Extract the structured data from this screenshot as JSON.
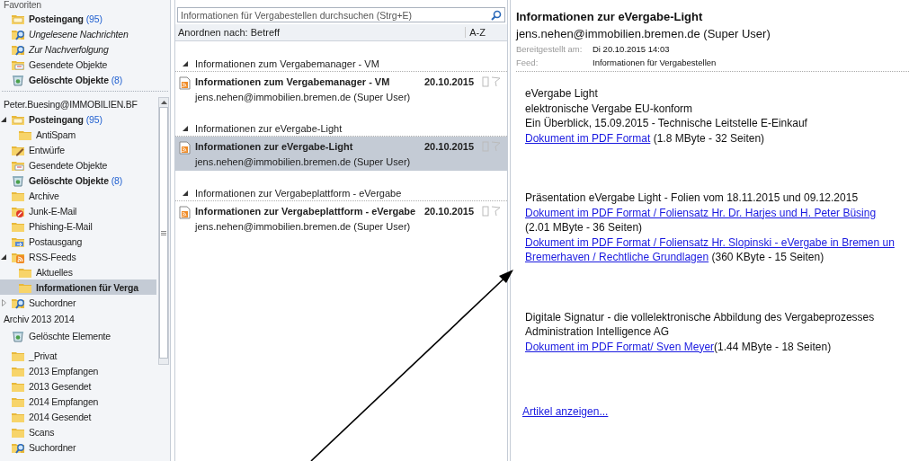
{
  "sidebar": {
    "favorites_header": "Favoriten",
    "favorites": [
      {
        "label": "Posteingang",
        "kind": "inbox",
        "bold": true,
        "italic": false,
        "count": "(95)",
        "selected": false
      },
      {
        "label": "Ungelesene Nachrichten",
        "kind": "search",
        "bold": false,
        "italic": true,
        "selected": false
      },
      {
        "label": "Zur Nachverfolgung",
        "kind": "search",
        "bold": false,
        "italic": true,
        "selected": false
      },
      {
        "label": "Gesendete Objekte",
        "kind": "sent",
        "bold": false,
        "italic": false,
        "selected": false
      },
      {
        "label": "Gelöschte Objekte",
        "kind": "deleted",
        "bold": true,
        "italic": false,
        "count": "(8)",
        "selected": false
      }
    ],
    "account": "Peter.Buesing@IMMOBILIEN.BF",
    "folders": [
      {
        "label": "Posteingang",
        "kind": "inbox",
        "bold": true,
        "italic": false,
        "count": "(95)",
        "selected": false,
        "expanded": true,
        "children": [
          {
            "label": "AntiSpam",
            "kind": "folder",
            "bold": false,
            "italic": false,
            "selected": false
          }
        ]
      },
      {
        "label": "Entwürfe",
        "kind": "drafts",
        "bold": false,
        "italic": false,
        "selected": false
      },
      {
        "label": "Gesendete Objekte",
        "kind": "sent",
        "bold": false,
        "italic": false,
        "selected": false
      },
      {
        "label": "Gelöschte Objekte",
        "kind": "deleted",
        "bold": true,
        "italic": false,
        "count": "(8)",
        "selected": false
      },
      {
        "label": "Archive",
        "kind": "folder",
        "bold": false,
        "italic": false,
        "selected": false
      },
      {
        "label": "Junk-E-Mail",
        "kind": "junk",
        "bold": false,
        "italic": false,
        "selected": false
      },
      {
        "label": "Phishing-E-Mail",
        "kind": "folder",
        "bold": false,
        "italic": false,
        "selected": false
      },
      {
        "label": "Postausgang",
        "kind": "outbox",
        "bold": false,
        "italic": false,
        "selected": false
      },
      {
        "label": "RSS-Feeds",
        "kind": "rss",
        "bold": false,
        "italic": false,
        "selected": false,
        "expanded": true,
        "children": [
          {
            "label": "Aktuelles",
            "kind": "folder",
            "bold": false,
            "italic": false,
            "selected": false
          },
          {
            "label": "Informationen für Verga",
            "kind": "folder",
            "bold": true,
            "italic": false,
            "selected": true
          }
        ]
      },
      {
        "label": "Suchordner",
        "kind": "search",
        "bold": false,
        "italic": false,
        "selected": false,
        "expanded": false
      }
    ],
    "archive": "Archiv 2013 2014",
    "archive_folders": [
      {
        "label": "Gelöschte Elemente",
        "kind": "deleted",
        "bold": false,
        "italic": false,
        "selected": false
      },
      {
        "label": "_Privat",
        "kind": "folder",
        "bold": false,
        "italic": false,
        "selected": false
      },
      {
        "label": "2013 Empfangen",
        "kind": "folder",
        "bold": false,
        "italic": false,
        "selected": false
      },
      {
        "label": "2013 Gesendet",
        "kind": "folder",
        "bold": false,
        "italic": false,
        "selected": false
      },
      {
        "label": "2014 Empfangen",
        "kind": "folder",
        "bold": false,
        "italic": false,
        "selected": false
      },
      {
        "label": "2014 Gesendet",
        "kind": "folder",
        "bold": false,
        "italic": false,
        "selected": false
      },
      {
        "label": "Scans",
        "kind": "folder",
        "bold": false,
        "italic": false,
        "selected": false
      },
      {
        "label": "Suchordner",
        "kind": "search",
        "bold": false,
        "italic": false,
        "selected": false
      }
    ]
  },
  "message_list": {
    "search": {
      "placeholder": "Informationen für Vergabestellen durchsuchen (Strg+E)"
    },
    "sort": {
      "label": "Anordnen nach: Betreff",
      "order": "A-Z"
    },
    "groups": [
      {
        "title": "Informationen zum Vergabemanager - VM",
        "messages": [
          {
            "subject": "Informationen zum Vergabemanager - VM",
            "sender": "jens.nehen@immobilien.bremen.de (Super User)",
            "date": "20.10.2015",
            "selected": false
          }
        ]
      },
      {
        "title": "Informationen zur eVergabe-Light",
        "messages": [
          {
            "subject": "Informationen zur eVergabe-Light",
            "sender": "jens.nehen@immobilien.bremen.de (Super User)",
            "date": "20.10.2015",
            "selected": true
          }
        ]
      },
      {
        "title": "Informationen zur Vergabeplattform - eVergabe",
        "messages": [
          {
            "subject": "Informationen zur Vergabeplattform - eVergabe",
            "sender": "jens.nehen@immobilien.bremen.de (Super User)",
            "date": "20.10.2015",
            "selected": false
          }
        ]
      }
    ]
  },
  "reading_pane": {
    "title": "Informationen zur eVergabe-Light",
    "sender": "jens.nehen@immobilien.bremen.de (Super User)",
    "meta": [
      {
        "label": "Bereitgestellt am:",
        "value": "Di 20.10.2015 14:03"
      },
      {
        "label": "Feed:",
        "value": "Informationen für Vergabestellen"
      }
    ],
    "paragraphs": [
      [
        [
          {
            "text": "eVergabe Light",
            "link": false
          }
        ],
        [
          {
            "text": "elektronische Vergabe EU-konform",
            "link": false
          }
        ],
        [
          {
            "text": "Ein Überblick, 15.09.2015 - Technische Leitstelle E-Einkauf",
            "link": false
          }
        ],
        [
          {
            "text": "Dokument im PDF Format",
            "link": true
          },
          {
            "text": " (1.8 MByte - 32 Seiten)",
            "link": false
          }
        ]
      ],
      [
        [
          {
            "text": "Präsentation eVergabe Light - Folien vom 18.11.2015 und 09.12.2015",
            "link": false
          }
        ],
        [
          {
            "text": "Dokument im PDF Format / Foliensatz Hr. Dr. Harjes und H. Peter Büsing",
            "link": true
          }
        ],
        [
          {
            "text": "(2.01 MByte - 36 Seiten)",
            "link": false
          }
        ],
        [
          {
            "text": "Dokument im PDF Format / Foliensatz Hr. Slopinski - eVergabe in Bremen un",
            "link": true
          }
        ],
        [
          {
            "text": "Bremerhaven / Rechtliche Grundlagen",
            "link": true
          },
          {
            "text": " (360 KByte - 15 Seiten)",
            "link": false
          }
        ]
      ],
      [
        [
          {
            "text": "Digitale Signatur - die vollelektronische Abbildung des Vergabeprozesses",
            "link": false
          }
        ],
        [
          {
            "text": "Administration Intelligence AG",
            "link": false
          }
        ],
        [
          {
            "text": "Dokument im PDF Format/ Sven Meyer",
            "link": true
          },
          {
            "text": "(1.44 MByte - 18 Seiten)",
            "link": false
          }
        ]
      ]
    ],
    "footer_link": "Artikel anzeigen..."
  }
}
